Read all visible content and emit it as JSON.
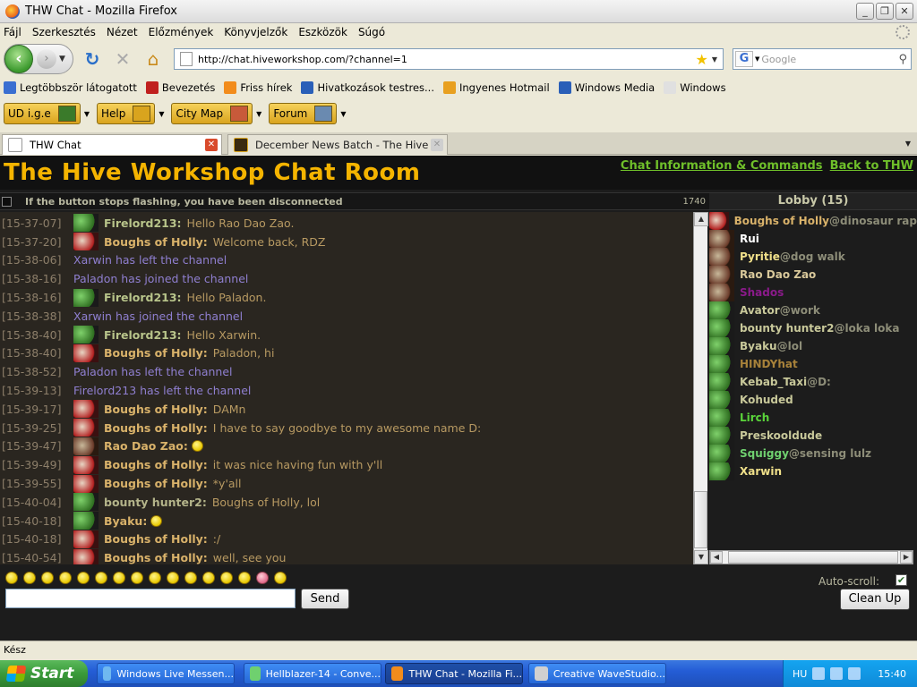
{
  "window": {
    "title": "THW Chat - Mozilla Firefox"
  },
  "menu": [
    "Fájl",
    "Szerkesztés",
    "Nézet",
    "Előzmények",
    "Könyvjelzők",
    "Eszközök",
    "Súgó"
  ],
  "nav": {
    "url": "http://chat.hiveworkshop.com/?channel=1",
    "search_placeholder": "Google"
  },
  "bookmarks": [
    {
      "label": "Legtöbbször látogatott",
      "color": "#3a6fd1"
    },
    {
      "label": "Bevezetés",
      "color": "#c0201e"
    },
    {
      "label": "Friss hírek",
      "color": "#f28c1c"
    },
    {
      "label": "Hivatkozások testres...",
      "color": "#2a5fb8"
    },
    {
      "label": "Ingyenes Hotmail",
      "color": "#e8a020"
    },
    {
      "label": "Windows Media",
      "color": "#2a5fb8"
    },
    {
      "label": "Windows",
      "color": "#e0e0e0"
    }
  ],
  "addons": [
    {
      "label": "UD i.g.e",
      "icon_color": "#3a7a2a"
    },
    {
      "label": "Help",
      "icon_color": "#d9a41e"
    },
    {
      "label": "City Map",
      "icon_color": "#c85a3a"
    },
    {
      "label": "Forum",
      "icon_color": "#6a8ab0"
    }
  ],
  "tabs": [
    {
      "label": "THW Chat"
    },
    {
      "label": "December News Batch - The Hive Wor..."
    }
  ],
  "chat": {
    "title": "The Hive Workshop Chat Room",
    "link_info": "Chat Information & Commands",
    "link_back": "Back to THW",
    "disconnect_notice": "If the button stops flashing, you have been disconnected",
    "counter": "1740",
    "lobby": "Lobby (15)",
    "auto_scroll_label": "Auto-scroll:",
    "auto_scroll_checked": "✔",
    "send_label": "Send",
    "cleanup_label": "Clean Up",
    "input_value": "",
    "messages": [
      {
        "ts": "[15-37-07]",
        "kind": "msg",
        "avatar": "green",
        "nick": "Firelord213:",
        "text": "Hello Rao Dao Zao.",
        "nick_style": "green"
      },
      {
        "ts": "[15-37-20]",
        "kind": "msg",
        "avatar": "red",
        "nick": "Boughs of Holly:",
        "text": "Welcome back, RDZ",
        "nick_style": "gold"
      },
      {
        "ts": "[15-38-06]",
        "kind": "sys",
        "text": "Xarwin has left the channel"
      },
      {
        "ts": "[15-38-16]",
        "kind": "sys",
        "text": "Paladon has joined the channel"
      },
      {
        "ts": "[15-38-16]",
        "kind": "msg",
        "avatar": "green",
        "nick": "Firelord213:",
        "text": "Hello Paladon.",
        "nick_style": "green"
      },
      {
        "ts": "[15-38-38]",
        "kind": "sys",
        "text": "Xarwin has joined the channel"
      },
      {
        "ts": "[15-38-40]",
        "kind": "msg",
        "avatar": "green",
        "nick": "Firelord213:",
        "text": "Hello Xarwin.",
        "nick_style": "green"
      },
      {
        "ts": "[15-38-40]",
        "kind": "msg",
        "avatar": "red",
        "nick": "Boughs of Holly:",
        "text": "Paladon, hi",
        "nick_style": "gold"
      },
      {
        "ts": "[15-38-52]",
        "kind": "sys",
        "text": "Paladon has left the channel"
      },
      {
        "ts": "[15-39-13]",
        "kind": "sys",
        "text": "Firelord213 has left the channel"
      },
      {
        "ts": "[15-39-17]",
        "kind": "msg",
        "avatar": "red",
        "nick": "Boughs of Holly:",
        "text": "DAMn",
        "nick_style": "gold"
      },
      {
        "ts": "[15-39-25]",
        "kind": "msg",
        "avatar": "red",
        "nick": "Boughs of Holly:",
        "text": "I have to say goodbye to my awesome name D:",
        "nick_style": "gold"
      },
      {
        "ts": "[15-39-47]",
        "kind": "msg",
        "avatar": "rdz",
        "nick": "Rao Dao Zao:",
        "text": "",
        "smiley": true,
        "nick_style": "gold"
      },
      {
        "ts": "[15-39-49]",
        "kind": "msg",
        "avatar": "red",
        "nick": "Boughs of Holly:",
        "text": "it was nice having fun with y'll",
        "nick_style": "gold"
      },
      {
        "ts": "[15-39-55]",
        "kind": "msg",
        "avatar": "red",
        "nick": "Boughs of Holly:",
        "text": "*y'all",
        "nick_style": "gold"
      },
      {
        "ts": "[15-40-04]",
        "kind": "msg",
        "avatar": "green",
        "nick": "bounty hunter2:",
        "text": "Boughs of Holly, lol",
        "nick_style": "orc"
      },
      {
        "ts": "[15-40-18]",
        "kind": "msg",
        "avatar": "green",
        "nick": "Byaku:",
        "text": "",
        "smiley": true,
        "nick_style": "gold"
      },
      {
        "ts": "[15-40-18]",
        "kind": "msg",
        "avatar": "red",
        "nick": "Boughs of Holly:",
        "text": ":/",
        "nick_style": "gold"
      },
      {
        "ts": "[15-40-54]",
        "kind": "msg",
        "avatar": "red",
        "nick": "Boughs of Holly:",
        "text": "well, see you",
        "nick_style": "gold"
      }
    ],
    "users": [
      {
        "name": "Boughs of Holly",
        "status": "@dinosaur rap",
        "color": "#d9b26a",
        "avatar": "red"
      },
      {
        "name": "Rui",
        "status": "",
        "color": "#ffffff",
        "avatar": "rdz"
      },
      {
        "name": "Pyritie",
        "status": "@dog walk",
        "color": "#f0e08a",
        "avatar": "rdz"
      },
      {
        "name": "Rao Dao Zao",
        "status": "",
        "color": "#d9c89a",
        "avatar": "rdz"
      },
      {
        "name": "Shados",
        "status": "",
        "color": "#8a1a8a",
        "avatar": "rdz"
      },
      {
        "name": "Avator",
        "status": "@work",
        "color": "#c8c89a",
        "avatar": "green"
      },
      {
        "name": "bounty hunter2",
        "status": "@loka loka",
        "color": "#c8c89a",
        "avatar": "green"
      },
      {
        "name": "Byaku",
        "status": "@lol",
        "color": "#c8c89a",
        "avatar": "green"
      },
      {
        "name": "HINDYhat",
        "status": "",
        "color": "#a8823a",
        "avatar": "green"
      },
      {
        "name": "Kebab_Taxi",
        "status": "@D:",
        "color": "#c8c89a",
        "avatar": "green"
      },
      {
        "name": "Kohuded",
        "status": "",
        "color": "#c8c89a",
        "avatar": "green"
      },
      {
        "name": "Lirch",
        "status": "",
        "color": "#5ad43a",
        "avatar": "green"
      },
      {
        "name": "Preskooldude",
        "status": "",
        "color": "#c8c89a",
        "avatar": "green"
      },
      {
        "name": "Squiggy",
        "status": "@sensing lulz",
        "color": "#6fd06f",
        "avatar": "green"
      },
      {
        "name": "Xarwin",
        "status": "",
        "color": "#f0e08a",
        "avatar": "green"
      }
    ],
    "smileys": [
      "yellow",
      "yellow",
      "yellow",
      "yellow",
      "yellow",
      "yellow",
      "yellow",
      "yellow",
      "yellow",
      "yellow",
      "yellow",
      "yellow",
      "yellow",
      "yellow",
      "pink",
      "yellow"
    ]
  },
  "statusbar": {
    "text": "Kész"
  },
  "taskbar": {
    "start_label": "Start",
    "tasks": [
      {
        "label": "Windows Live Messen...",
        "icon": "#6fb8f0"
      },
      {
        "label": "Hellblazer-14 - Conve...",
        "icon": "#6fd06f"
      },
      {
        "label": "THW Chat - Mozilla Fi...",
        "icon": "#f28c1c"
      },
      {
        "label": "Creative WaveStudio...",
        "icon": "#d0d0d0"
      }
    ],
    "lang": "HU",
    "clock": "15:40"
  }
}
